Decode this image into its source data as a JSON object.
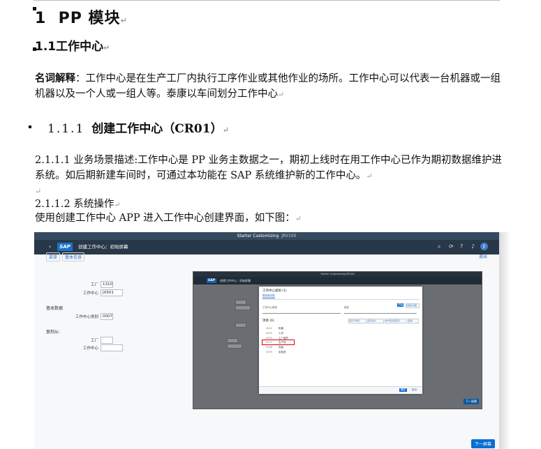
{
  "heading1": {
    "number": "1",
    "title": "PP 模块"
  },
  "heading2": {
    "number": "1.1",
    "title": "工作中心"
  },
  "definition": {
    "label": "名词解释",
    "text": "：工作中心是在生产工厂内执行工序作业或其他作业的场所。工作中心可以代表一台机器或一组机器以及一个人或一组人等。泰康以车间划分工作中心"
  },
  "heading3": {
    "number": "1.1.1",
    "title": "创建工作中心（CR01）"
  },
  "scenario": {
    "text": "2.1.1.1 业务场景描述:工作中心是 PP 业务主数据之一，期初上线时在用工作中心已作为期初数据维护进系统。如后期新建车间时，可通过本功能在 SAP 系统维护新的工作中心。"
  },
  "operation": {
    "title": "2.1.1.2 系统操作",
    "text": "使用创建工作中心 APP 进入工作中心创建界面，如下图："
  },
  "paragraph_mark": "↵",
  "screenshot": {
    "window_title": "Starter Customizing",
    "window_id": "JRV100",
    "logo": "SAP",
    "app_title": "创建工作中心：初始屏幕",
    "menu": [
      "菜单",
      "基本信息"
    ],
    "exit": "退出",
    "fields": [
      {
        "label": "工厂",
        "value": "1310"
      },
      {
        "label": "工作中心",
        "value": "JX501"
      }
    ],
    "section_basic": "基本数据",
    "category_label": "工作中心类别",
    "category_value": "0007",
    "section_copy": "复制从:",
    "copy_fields": [
      {
        "label": "工厂",
        "value": ""
      },
      {
        "label": "工作中心",
        "value": ""
      }
    ],
    "next_button": "下一屏幕",
    "avatar": "JI",
    "nested": {
      "window_title": "Starter Customizing",
      "window_id": "JRV100",
      "logo": "SAP",
      "app_title": "创建工作中心：初始屏幕",
      "dialog": {
        "title": "工作中心类别 (1)",
        "tab": "限制值范围",
        "field_label": "工作中心类别",
        "desc_label": "描述",
        "go_button": "开始",
        "adapt_button": "隐藏过滤器",
        "items_label": "项目 (6)",
        "toolbar": [
          "显示平均值",
          "显示总计",
          "作为空白值显示",
          "设置"
        ],
        "rows": [
          {
            "code": "0001",
            "text": "机器"
          },
          {
            "code": "0002",
            "text": "人员"
          },
          {
            "code": "0005",
            "text": "工厂维护"
          },
          {
            "code": "0007",
            "text": "生产线"
          },
          {
            "code": "0008",
            "text": "包装"
          },
          {
            "code": "0009",
            "text": "实验室"
          }
        ],
        "highlighted_row": 3,
        "ok_button": "确定",
        "cancel_button": "取消"
      }
    }
  }
}
